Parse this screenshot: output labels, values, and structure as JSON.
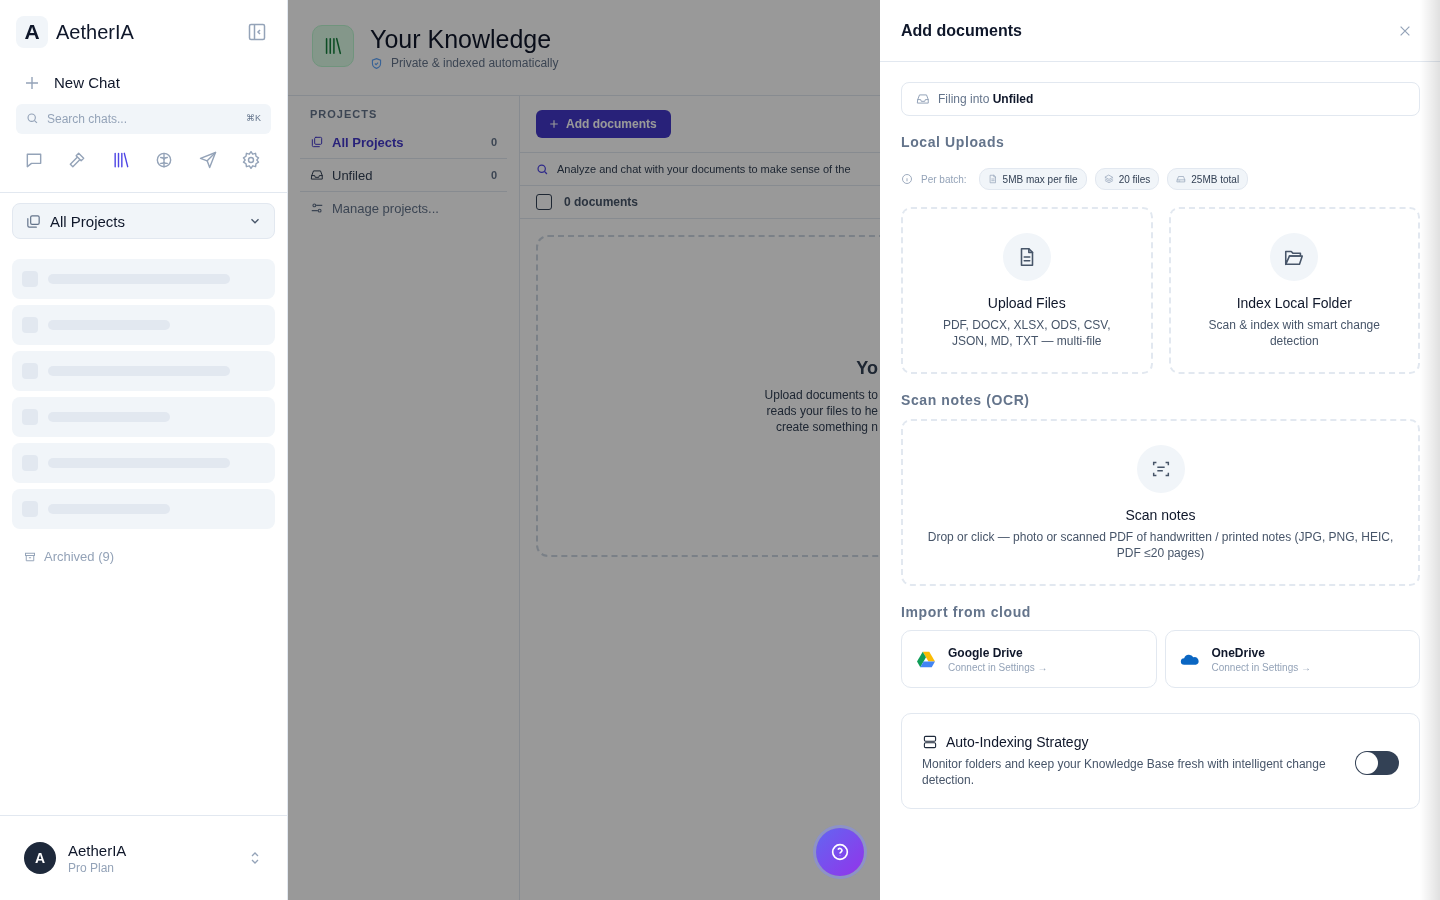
{
  "sidebar": {
    "logo_letter": "A",
    "app_name": "AetherIA",
    "new_chat": "New Chat",
    "search": {
      "placeholder": "Search chats...",
      "shortcut": "⌘K"
    },
    "nav_icons": [
      {
        "kind": "chat",
        "selected": false
      },
      {
        "kind": "hammer",
        "selected": false
      },
      {
        "kind": "library",
        "selected": true
      },
      {
        "kind": "brain",
        "selected": false
      },
      {
        "kind": "send",
        "selected": false
      },
      {
        "kind": "settings",
        "selected": false
      }
    ],
    "project_selector": "All Projects",
    "archived": "Archived (9)",
    "user": {
      "initial": "A",
      "name": "AetherIA",
      "plan": "Pro Plan"
    }
  },
  "knowledge": {
    "title": "Your Knowledge",
    "subtitle": "Private & indexed automatically",
    "projects_heading": "PROJECTS",
    "projects": [
      {
        "kind": "stack",
        "name": "All Projects",
        "count": "0",
        "selected": true
      },
      {
        "kind": "inbox",
        "name": "Unfiled",
        "count": "0",
        "selected": false
      }
    ],
    "manage": "Manage projects...",
    "add_button": "Add documents",
    "hint": "Analyze and chat with your documents to make sense of the",
    "documents_count": "0 documents",
    "select_all_checked": false,
    "empty_state": {
      "title": "Yo",
      "lines": [
        "Upload documents to",
        "reads your files to he",
        "create something n"
      ]
    }
  },
  "drawer": {
    "title": "Add documents",
    "filing": "Filing into **Unfiled**",
    "local_heading": "Local Uploads",
    "batch_label": "Per batch:",
    "chips": [
      {
        "kind": "file",
        "label": "5MB max per file"
      },
      {
        "kind": "layers",
        "label": "20 files"
      },
      {
        "kind": "disk",
        "label": "25MB total"
      }
    ],
    "upload_cards": [
      {
        "kind": "file",
        "title": "Upload Files",
        "description": "PDF, DOCX, XLSX, ODS, CSV, JSON, MD, TXT — multi-file"
      },
      {
        "kind": "folder",
        "title": "Index Local Folder",
        "description": "Scan & index with smart change detection"
      }
    ],
    "scan_heading": "Scan notes (OCR)",
    "scan_card": {
      "title": "Scan notes",
      "description": "Drop or click — photo or scanned PDF of handwritten / printed notes (JPG, PNG, HEIC, PDF ≤20 pages)"
    },
    "cloud_heading": "Import from cloud",
    "cloud": [
      {
        "kind": "gdrive",
        "name": "Google Drive",
        "action": "Connect in Settings →"
      },
      {
        "kind": "onedrive",
        "name": "OneDrive",
        "action": "Connect in Settings →"
      }
    ],
    "auto_index": {
      "title": "Auto-Indexing Strategy",
      "description": "Monitor folders and keep your Knowledge Base fresh with intelligent change detection.",
      "on": false
    }
  }
}
